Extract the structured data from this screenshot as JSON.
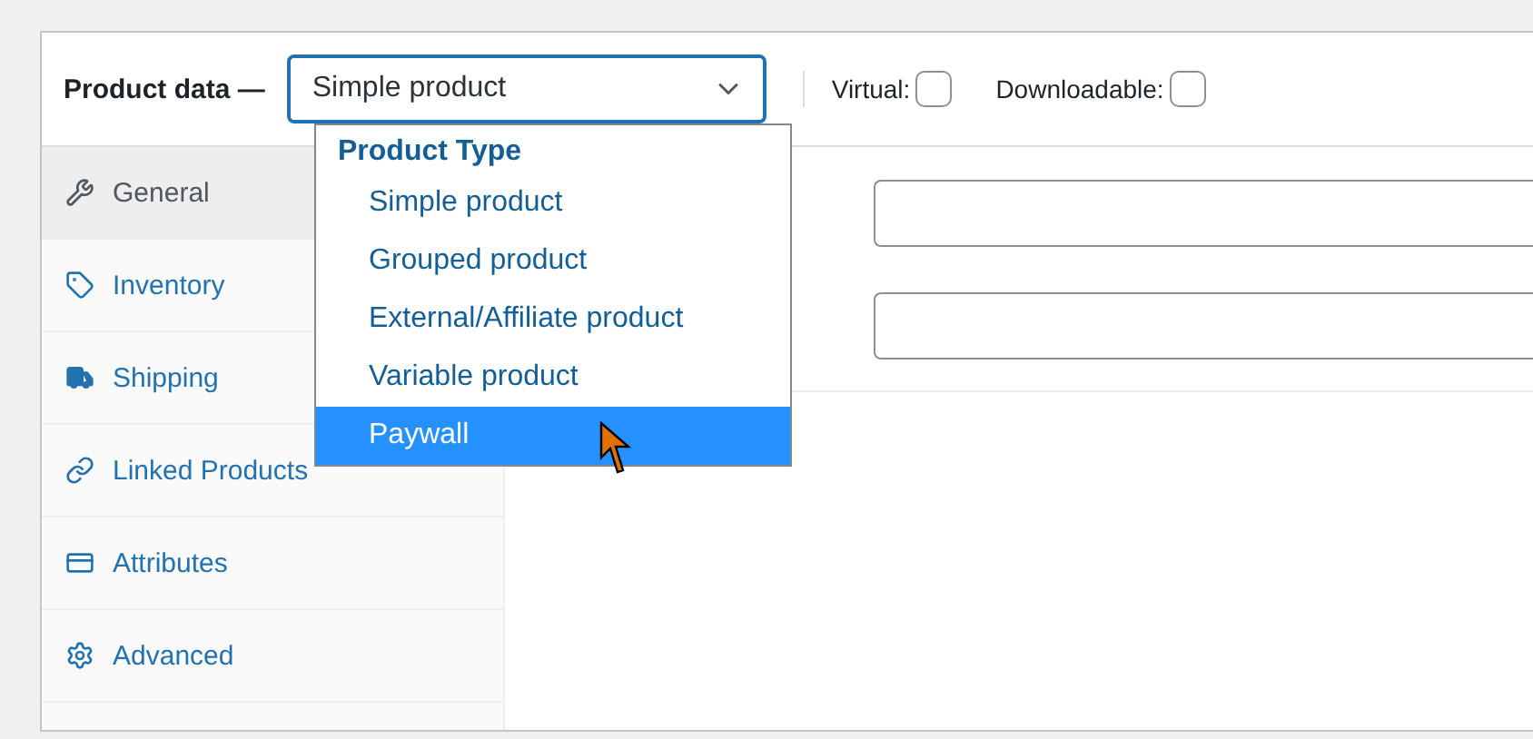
{
  "header": {
    "title": "Product data —",
    "product_type": {
      "value": "Simple product",
      "expanded": true
    }
  },
  "dropdown": {
    "group_label": "Product Type",
    "options": [
      {
        "label": "Simple product",
        "selected": false
      },
      {
        "label": "Grouped product",
        "selected": false
      },
      {
        "label": "External/Affiliate product",
        "selected": false
      },
      {
        "label": "Variable product",
        "selected": false
      },
      {
        "label": "Paywall",
        "selected": true
      }
    ]
  },
  "options": [
    {
      "label": "Virtual:",
      "checked": false
    },
    {
      "label": "Downloadable:",
      "checked": false
    }
  ],
  "tabs": [
    {
      "label": "General",
      "kind": "wrench",
      "selected": true
    },
    {
      "label": "Inventory",
      "kind": "tag",
      "selected": false
    },
    {
      "label": "Shipping",
      "kind": "truck",
      "selected": false
    },
    {
      "label": "Linked Products",
      "kind": "link",
      "selected": false
    },
    {
      "label": "Attributes",
      "kind": "list",
      "selected": false
    },
    {
      "label": "Advanced",
      "kind": "gear",
      "selected": false
    }
  ]
}
